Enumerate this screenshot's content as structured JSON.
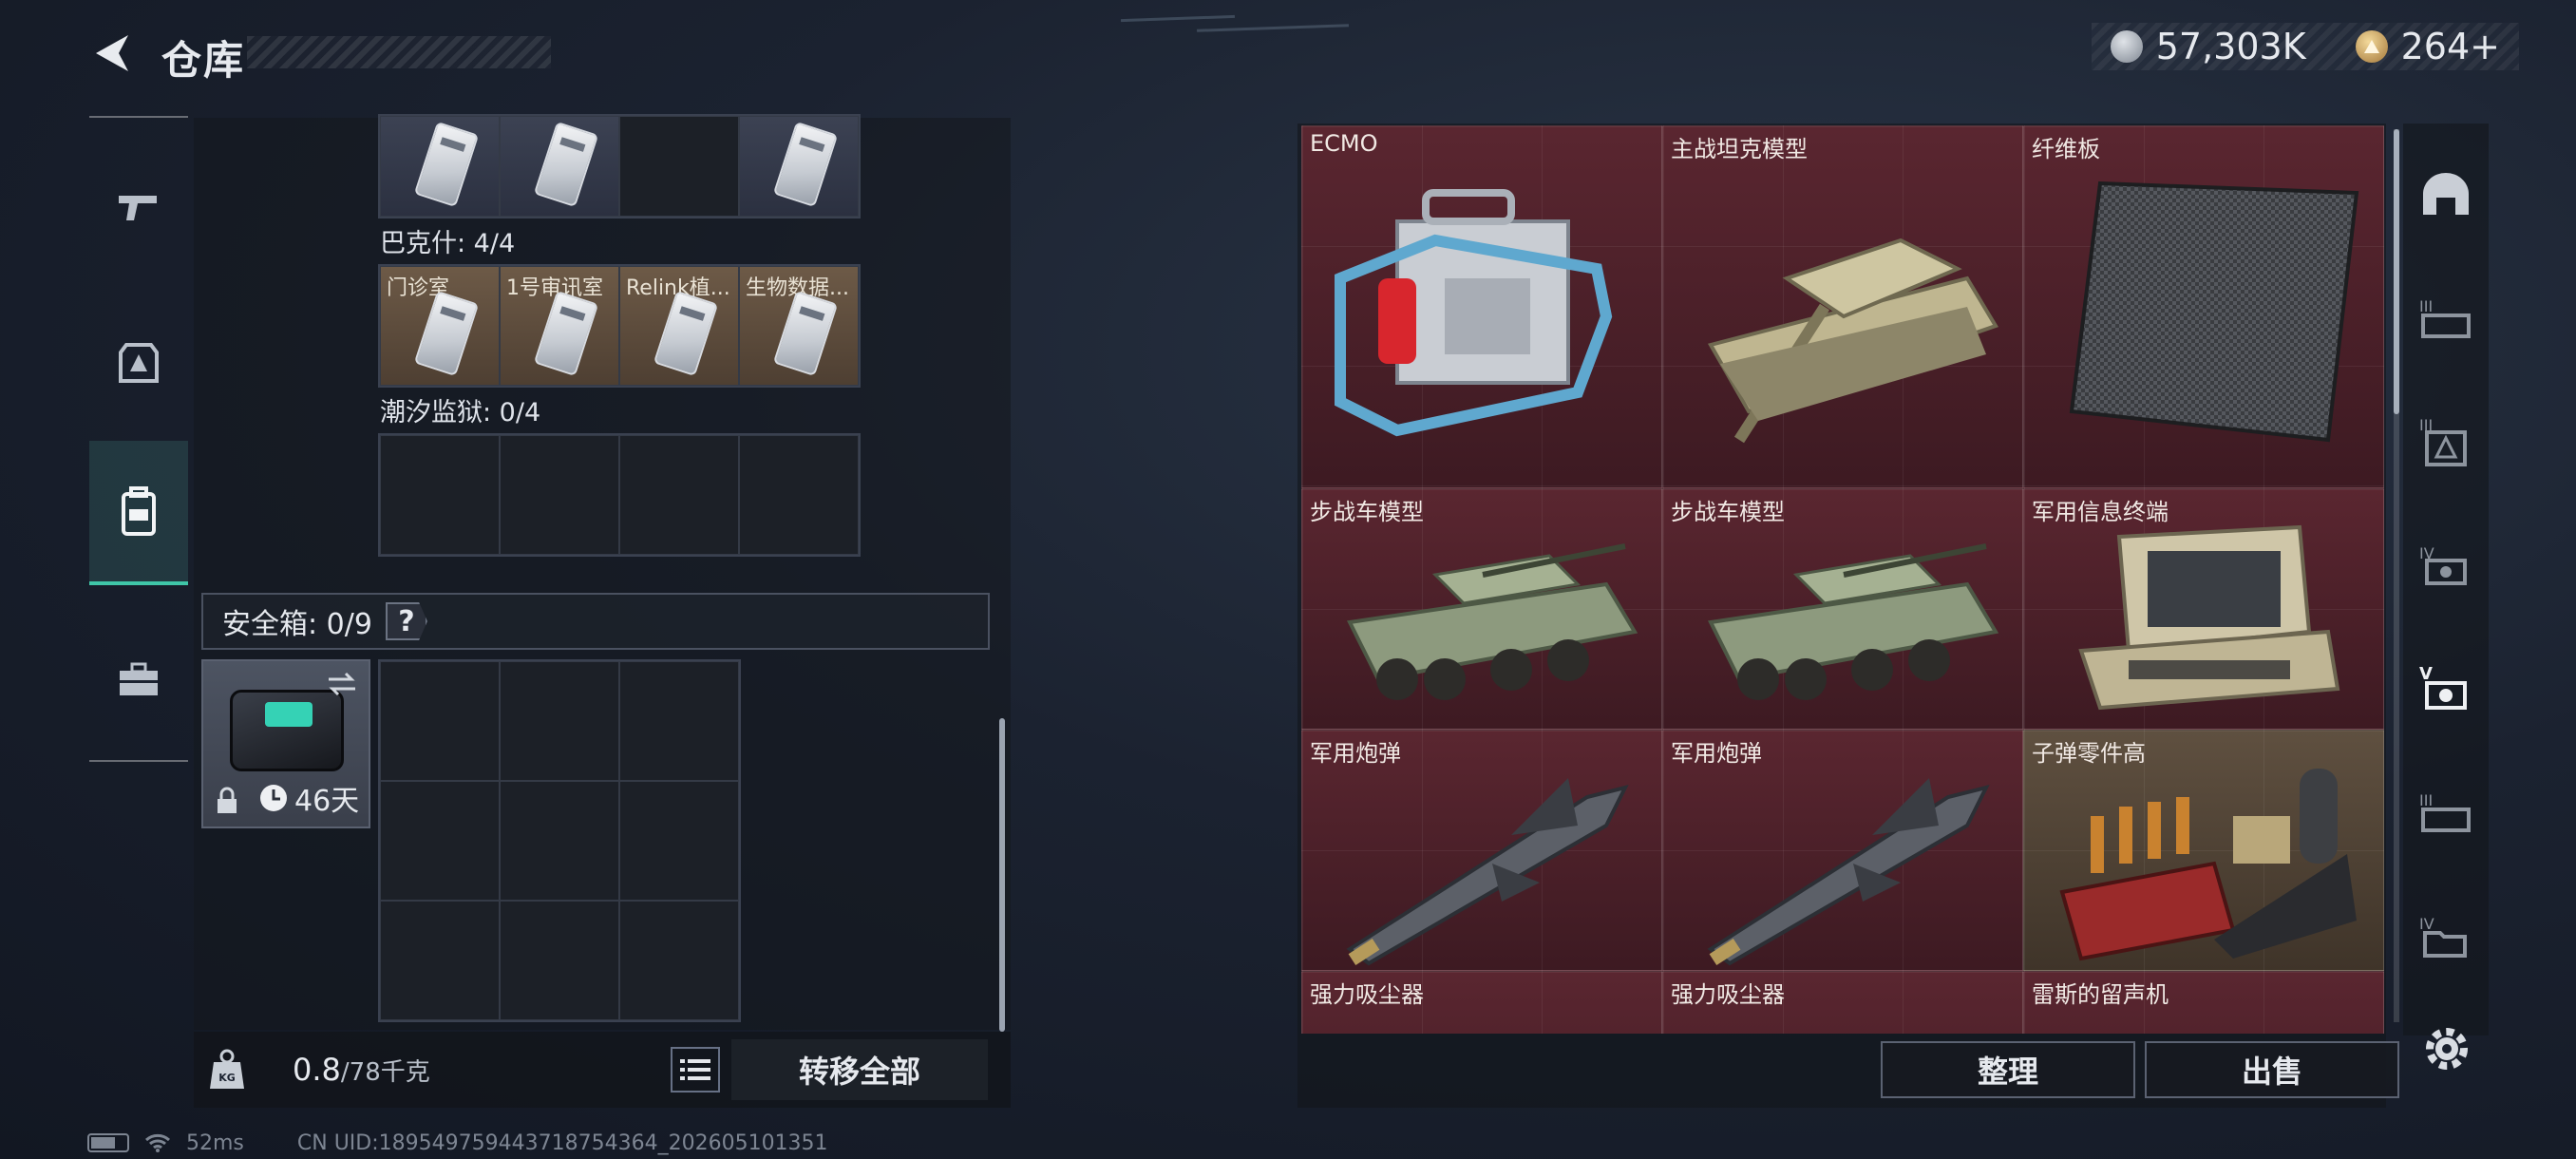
{
  "header": {
    "title": "仓库",
    "currency": {
      "silver_value": "57,303K",
      "gold_value": "264+"
    }
  },
  "left_nav": [
    "gun-icon",
    "armor-icon",
    "backpack-icon",
    "toolbox-icon"
  ],
  "inventory": {
    "top_row_cells": [
      "card",
      "card",
      "empty",
      "card"
    ],
    "bakeshi_label": "巴克什: 4/4",
    "bakeshi_cells": [
      "门诊室",
      "1号审讯室",
      "Relink植...",
      "生物数据..."
    ],
    "tidal_label": "潮汐监狱: 0/4",
    "safebox_label": "安全箱: 0/9",
    "safebox_help": "?",
    "safebox_timer": "46天",
    "weight_value": "0.8",
    "weight_capacity": "/78千克",
    "transfer_all": "转移全部"
  },
  "storage": {
    "items": [
      {
        "name": "ECMO",
        "art": "ecmo"
      },
      {
        "name": "主战坦克模型",
        "art": "tank"
      },
      {
        "name": "纤维板",
        "art": "fiber"
      },
      {
        "name": "步战车模型",
        "art": "ifv"
      },
      {
        "name": "步战车模型",
        "art": "ifv"
      },
      {
        "name": "军用信息终端",
        "art": "terminal"
      },
      {
        "name": "军用炮弹",
        "art": "shell"
      },
      {
        "name": "军用炮弹",
        "art": "shell"
      },
      {
        "name": "子弹零件高",
        "art": "parts"
      },
      {
        "name": "强力吸尘器",
        "art": "none"
      },
      {
        "name": "强力吸尘器",
        "art": "none"
      },
      {
        "name": "雷斯的留声机",
        "art": "none"
      }
    ],
    "sort_label": "整理",
    "sell_label": "出售"
  },
  "right_nav": [
    "helmet-tab",
    "tier3-tab",
    "tier3-tab-b",
    "tier4-tab",
    "tier5-tab",
    "tier3-tab-c",
    "tier4-tab-b"
  ],
  "status": {
    "ping": "52ms",
    "uid": "CN UID:1895497594437187543​64_202605101351"
  }
}
